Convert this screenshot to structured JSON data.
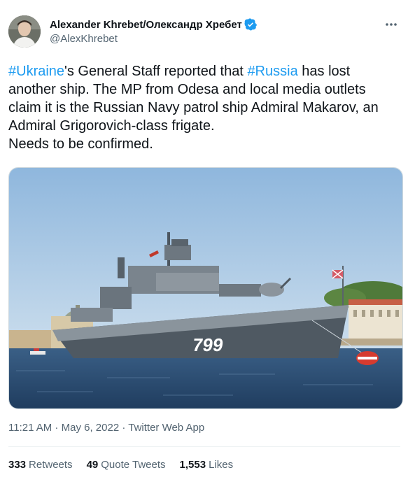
{
  "author": {
    "display_name": "Alexander Khrebet/Олександр Хребет",
    "handle": "@AlexKhrebet",
    "verified_icon": "verified-badge-icon",
    "accent_color": "#1d9bf0"
  },
  "tweet": {
    "hashtag_1": "#Ukraine",
    "text_1": "'s General Staff reported that ",
    "hashtag_2": "#Russia",
    "text_2": " has lost another ship. The MP from Odesa and local media outlets claim it is the Russian Navy patrol ship Admiral Makarov, an Admiral Grigorovich-class frigate.",
    "text_3": "Needs to be confirmed."
  },
  "media": {
    "hull_number": "799"
  },
  "meta": {
    "time": "11:21 AM",
    "sep1": " · ",
    "date": "May 6, 2022",
    "sep2": " · ",
    "source": "Twitter Web App"
  },
  "stats": {
    "retweets_count": "333",
    "retweets_label": "Retweets",
    "quotes_count": "49",
    "quotes_label": "Quote Tweets",
    "likes_count": "1,553",
    "likes_label": "Likes"
  }
}
